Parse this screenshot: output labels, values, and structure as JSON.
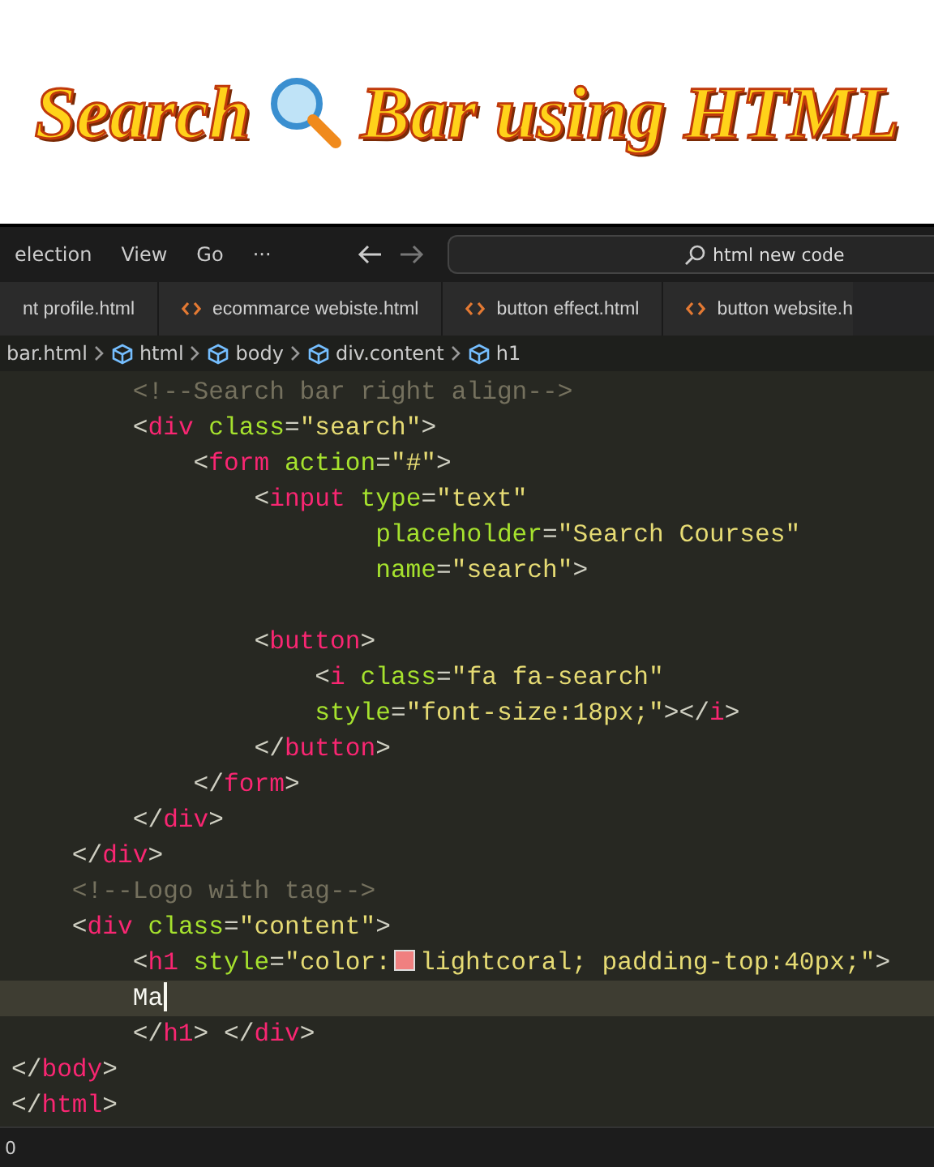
{
  "video_title": {
    "before_icon": "Search",
    "after_icon": "Bar using HTML"
  },
  "menu_bar": {
    "items": [
      "election",
      "View",
      "Go",
      "···"
    ],
    "command_center": {
      "value": "html new code"
    }
  },
  "tabs": [
    {
      "label": "nt profile.html",
      "icon": false
    },
    {
      "label": "ecommarce webiste.html",
      "icon": true
    },
    {
      "label": "button effect.html",
      "icon": true
    },
    {
      "label": "button website.h",
      "icon": true
    }
  ],
  "breadcrumb": [
    {
      "label": "bar.html",
      "kind": "file"
    },
    {
      "label": "html",
      "kind": "element"
    },
    {
      "label": "body",
      "kind": "element"
    },
    {
      "label": "div.content",
      "kind": "element"
    },
    {
      "label": "h1",
      "kind": "element"
    }
  ],
  "editor": {
    "lines": [
      {
        "current": false,
        "tokens": [
          {
            "text": "        <!--Search bar right align-->",
            "kind": "comment"
          }
        ]
      },
      {
        "current": false,
        "tokens": [
          {
            "text": "        <",
            "kind": "punct"
          },
          {
            "text": "div",
            "kind": "tag"
          },
          {
            "text": " class",
            "kind": "attr"
          },
          {
            "text": "=",
            "kind": "punct"
          },
          {
            "text": "\"search\"",
            "kind": "str"
          },
          {
            "text": ">",
            "kind": "punct"
          }
        ]
      },
      {
        "current": false,
        "tokens": [
          {
            "text": "            <",
            "kind": "punct"
          },
          {
            "text": "form",
            "kind": "tag"
          },
          {
            "text": " action",
            "kind": "attr"
          },
          {
            "text": "=",
            "kind": "punct"
          },
          {
            "text": "\"#\"",
            "kind": "str"
          },
          {
            "text": ">",
            "kind": "punct"
          }
        ]
      },
      {
        "current": false,
        "tokens": [
          {
            "text": "                <",
            "kind": "punct"
          },
          {
            "text": "input",
            "kind": "tag"
          },
          {
            "text": " type",
            "kind": "attr"
          },
          {
            "text": "=",
            "kind": "punct"
          },
          {
            "text": "\"text\"",
            "kind": "str"
          }
        ]
      },
      {
        "current": false,
        "tokens": [
          {
            "text": "                        placeholder",
            "kind": "attr"
          },
          {
            "text": "=",
            "kind": "punct"
          },
          {
            "text": "\"Search Courses\"",
            "kind": "str"
          }
        ]
      },
      {
        "current": false,
        "tokens": [
          {
            "text": "                        name",
            "kind": "attr"
          },
          {
            "text": "=",
            "kind": "punct"
          },
          {
            "text": "\"search\"",
            "kind": "str"
          },
          {
            "text": ">",
            "kind": "punct"
          }
        ]
      },
      {
        "current": false
      },
      {
        "current": false,
        "tokens": [
          {
            "text": "                <",
            "kind": "punct"
          },
          {
            "text": "button",
            "kind": "tag"
          },
          {
            "text": ">",
            "kind": "punct"
          }
        ]
      },
      {
        "current": false,
        "tokens": [
          {
            "text": "                    <",
            "kind": "punct"
          },
          {
            "text": "i",
            "kind": "tag"
          },
          {
            "text": " class",
            "kind": "attr"
          },
          {
            "text": "=",
            "kind": "punct"
          },
          {
            "text": "\"fa fa-search\"",
            "kind": "str"
          }
        ]
      },
      {
        "current": false,
        "tokens": [
          {
            "text": "                    style",
            "kind": "attr"
          },
          {
            "text": "=",
            "kind": "punct"
          },
          {
            "text": "\"font-size:18px;\"",
            "kind": "str"
          },
          {
            "text": "></",
            "kind": "punct"
          },
          {
            "text": "i",
            "kind": "tag"
          },
          {
            "text": ">",
            "kind": "punct"
          }
        ]
      },
      {
        "current": false,
        "tokens": [
          {
            "text": "                </",
            "kind": "punct"
          },
          {
            "text": "button",
            "kind": "tag"
          },
          {
            "text": ">",
            "kind": "punct"
          }
        ]
      },
      {
        "current": false,
        "tokens": [
          {
            "text": "            </",
            "kind": "punct"
          },
          {
            "text": "form",
            "kind": "tag"
          },
          {
            "text": ">",
            "kind": "punct"
          }
        ]
      },
      {
        "current": false,
        "tokens": [
          {
            "text": "        </",
            "kind": "punct"
          },
          {
            "text": "div",
            "kind": "tag"
          },
          {
            "text": ">",
            "kind": "punct"
          }
        ]
      },
      {
        "current": false,
        "tokens": [
          {
            "text": "    </",
            "kind": "punct"
          },
          {
            "text": "div",
            "kind": "tag"
          },
          {
            "text": ">",
            "kind": "punct"
          }
        ]
      },
      {
        "current": false,
        "tokens": [
          {
            "text": "    <!--Logo with tag-->",
            "kind": "comment"
          }
        ]
      },
      {
        "current": false,
        "tokens": [
          {
            "text": "    <",
            "kind": "punct"
          },
          {
            "text": "div",
            "kind": "tag"
          },
          {
            "text": " class",
            "kind": "attr"
          },
          {
            "text": "=",
            "kind": "punct"
          },
          {
            "text": "\"content\"",
            "kind": "str"
          },
          {
            "text": ">",
            "kind": "punct"
          }
        ]
      },
      {
        "current": false,
        "tokens": [
          {
            "text": "        <",
            "kind": "punct"
          },
          {
            "text": "h1",
            "kind": "tag"
          },
          {
            "text": " style",
            "kind": "attr"
          },
          {
            "text": "=",
            "kind": "punct"
          },
          {
            "text": "\"color:",
            "kind": "str"
          },
          {
            "kind": "swatch",
            "color": "#f08080"
          },
          {
            "text": "lightcoral; padding-top:40px;\"",
            "kind": "str"
          },
          {
            "text": ">",
            "kind": "punct"
          }
        ]
      },
      {
        "current": true,
        "tokens": [
          {
            "text": "        Ma",
            "kind": "text"
          }
        ]
      },
      {
        "current": false,
        "tokens": [
          {
            "text": "        </",
            "kind": "punct"
          },
          {
            "text": "h1",
            "kind": "tag"
          },
          {
            "text": "> </",
            "kind": "punct"
          },
          {
            "text": "div",
            "kind": "tag"
          },
          {
            "text": ">",
            "kind": "punct"
          }
        ]
      },
      {
        "current": false,
        "tokens": [
          {
            "text": "</",
            "kind": "punct"
          },
          {
            "text": "body",
            "kind": "tag"
          },
          {
            "text": ">",
            "kind": "punct"
          }
        ]
      },
      {
        "current": false,
        "tokens": [
          {
            "text": "</",
            "kind": "punct"
          },
          {
            "text": "html",
            "kind": "tag"
          },
          {
            "text": ">",
            "kind": "punct"
          }
        ]
      }
    ]
  },
  "status_bar": {
    "text": "0"
  }
}
